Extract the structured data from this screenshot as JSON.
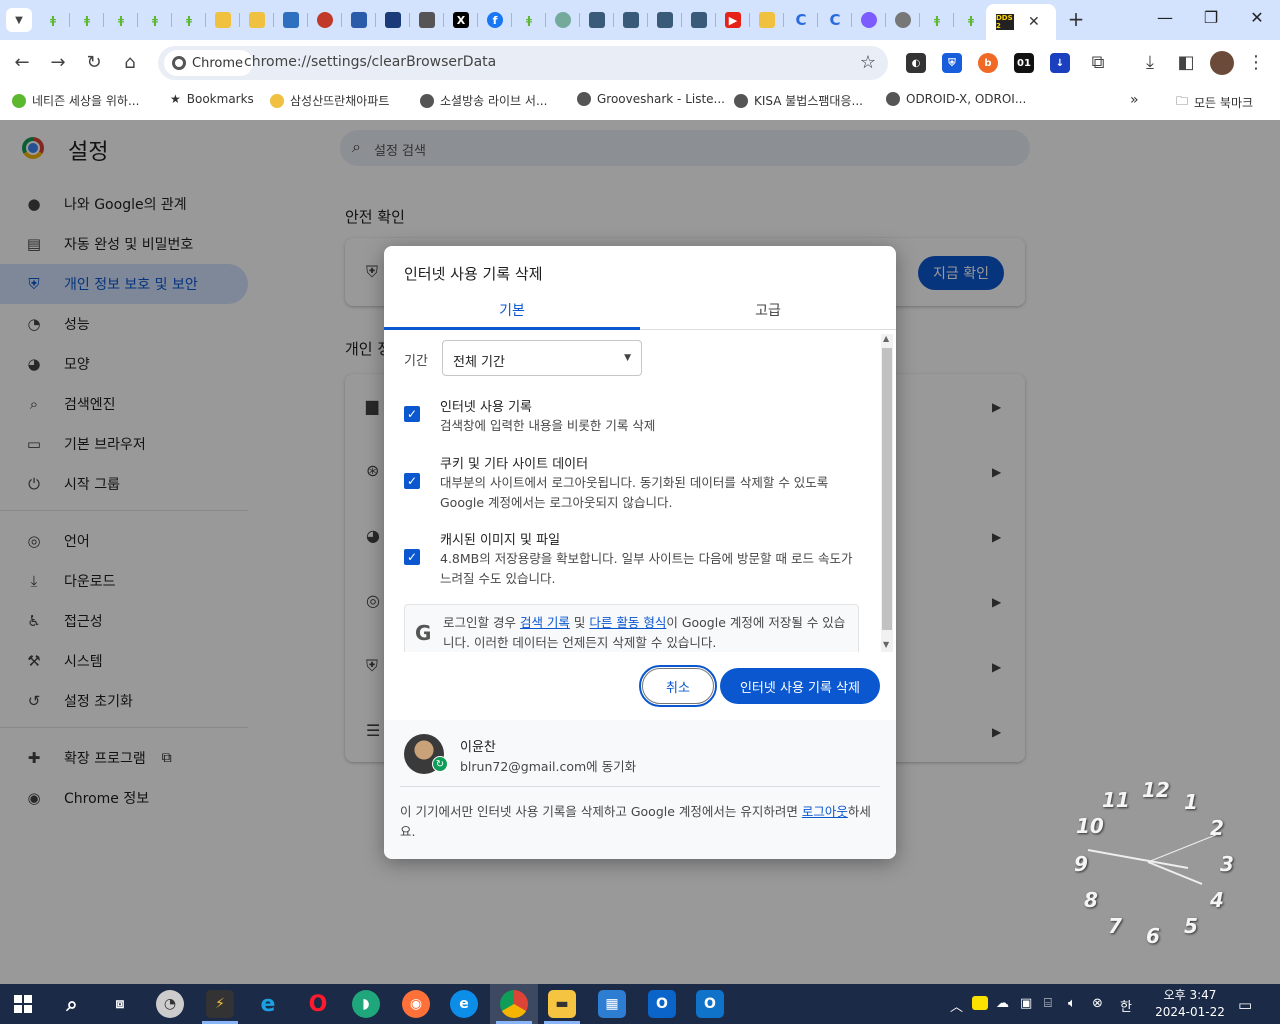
{
  "window": {
    "url": "chrome://settings/clearBrowserData",
    "chip_label": "Chrome",
    "active_tab_badge": "DDS 2"
  },
  "bookmarks": [
    {
      "label": "네티즌 세상을 위하..."
    },
    {
      "label": "Bookmarks"
    },
    {
      "label": "삼성산뜨란채아파트"
    },
    {
      "label": "소셜방송 라이브 서..."
    },
    {
      "label": "Grooveshark - Liste..."
    },
    {
      "label": "KISA 불법스팸대응..."
    },
    {
      "label": "ODROID-X, ODROI..."
    }
  ],
  "all_bookmarks": "모든 북마크",
  "settings": {
    "title": "설정",
    "search_placeholder": "설정 검색",
    "nav": [
      {
        "label": "나와 Google의 관계",
        "icon": "person-icon"
      },
      {
        "label": "자동 완성 및 비밀번호",
        "icon": "clipboard-icon"
      },
      {
        "label": "개인 정보 보호 및 보안",
        "icon": "shield-icon"
      },
      {
        "label": "성능",
        "icon": "speedometer-icon"
      },
      {
        "label": "모양",
        "icon": "palette-icon"
      },
      {
        "label": "검색엔진",
        "icon": "search-icon"
      },
      {
        "label": "기본 브라우저",
        "icon": "browser-icon"
      },
      {
        "label": "시작 그룹",
        "icon": "power-icon"
      },
      {
        "label": "언어",
        "icon": "globe-icon"
      },
      {
        "label": "다운로드",
        "icon": "download-icon"
      },
      {
        "label": "접근성",
        "icon": "accessibility-icon"
      },
      {
        "label": "시스템",
        "icon": "wrench-icon"
      },
      {
        "label": "설정 초기화",
        "icon": "history-icon"
      },
      {
        "label": "확장 프로그램",
        "icon": "puzzle-icon"
      },
      {
        "label": "Chrome 정보",
        "icon": "chrome-icon"
      }
    ],
    "safety_check_title": "안전 확인",
    "check_now": "지금 확인",
    "privacy_section_title": "개인 정"
  },
  "dialog": {
    "title": "인터넷 사용 기록 삭제",
    "tabs": [
      "기본",
      "고급"
    ],
    "period_label": "기간",
    "period_value": "전체 기간",
    "options": [
      {
        "title": "인터넷 사용 기록",
        "desc": "검색창에 입력한 내용을 비롯한 기록 삭제",
        "checked": true
      },
      {
        "title": "쿠키 및 기타 사이트 데이터",
        "desc": "대부분의 사이트에서 로그아웃됩니다. 동기화된 데이터를 삭제할 수 있도록 Google 계정에서는 로그아웃되지 않습니다.",
        "checked": true
      },
      {
        "title": "캐시된 이미지 및 파일",
        "desc": "4.8MB의 저장용량을 확보합니다. 일부 사이트는 다음에 방문할 때 로드 속도가 느려질 수도 있습니다.",
        "checked": true
      }
    ],
    "google_notice": {
      "prefix": "로그인할 경우 ",
      "link1": "검색 기록",
      "mid": " 및 ",
      "link2": "다른 활동 형식",
      "suffix": "이 Google 계정에 저장될 수 있습니다. 이러한 데이터는 언제든지 삭제할 수 있습니다."
    },
    "cancel_label": "취소",
    "delete_label": "인터넷 사용 기록 삭제",
    "account": {
      "name": "이윤찬",
      "email": "blrun72@gmail.com에 동기화"
    },
    "footer_note": {
      "text": "이 기기에서만 인터넷 사용 기록을 삭제하고 Google 계정에서는 유지하려면 ",
      "link": "로그아웃",
      "suffix": "하세요."
    }
  },
  "clock_numbers": [
    "12",
    "1",
    "2",
    "3",
    "4",
    "5",
    "6",
    "7",
    "8",
    "9",
    "10",
    "11"
  ],
  "taskbar": {
    "time": "오후 3:47",
    "date": "2024-01-22",
    "ime": "한"
  },
  "colors": {
    "accent": "#0b57d0",
    "tabstrip": "#d3e3fd",
    "taskbar": "#1b2a46"
  }
}
